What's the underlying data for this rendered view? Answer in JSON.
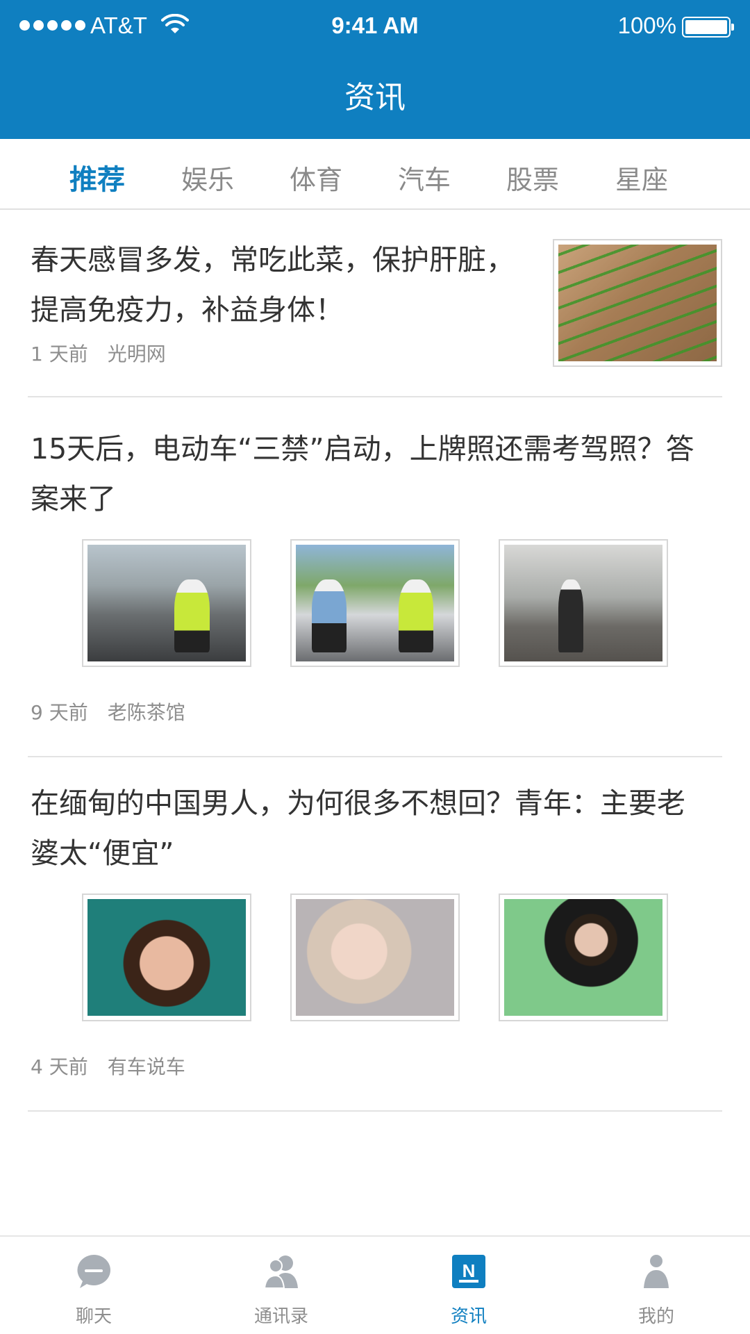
{
  "status_bar": {
    "carrier": "AT&T",
    "time": "9:41 AM",
    "battery": "100%"
  },
  "nav": {
    "title": "资讯"
  },
  "tabs": [
    {
      "label": "推荐",
      "active": true
    },
    {
      "label": "娱乐",
      "active": false
    },
    {
      "label": "体育",
      "active": false
    },
    {
      "label": "汽车",
      "active": false
    },
    {
      "label": "股票",
      "active": false
    },
    {
      "label": "星座",
      "active": false
    }
  ],
  "articles": [
    {
      "title_line1": "春天感冒多发，常吃此菜，保护肝脏，",
      "title_line2": "提高免疫力，补益身体！",
      "time": "1 天前",
      "source": "光明网"
    },
    {
      "title_line1": "15天后，电动车“三禁”启动，上牌照还需考驾照？答",
      "title_line2": "案来了",
      "time": "9 天前",
      "source": "老陈茶馆"
    },
    {
      "title_line1": "在缅甸的中国男人，为何很多不想回？青年：主要老",
      "title_line2": "婆太“便宜”",
      "time": "4 天前",
      "source": "有车说车"
    }
  ],
  "tabbar": [
    {
      "label": "聊天",
      "icon": "chat-icon",
      "active": false
    },
    {
      "label": "通讯录",
      "icon": "contacts-icon",
      "active": false
    },
    {
      "label": "资讯",
      "icon": "news-icon",
      "active": true
    },
    {
      "label": "我的",
      "icon": "profile-icon",
      "active": false
    }
  ],
  "colors": {
    "brand": "#0f7fc0",
    "text": "#333333",
    "muted": "#8e8e8e"
  }
}
